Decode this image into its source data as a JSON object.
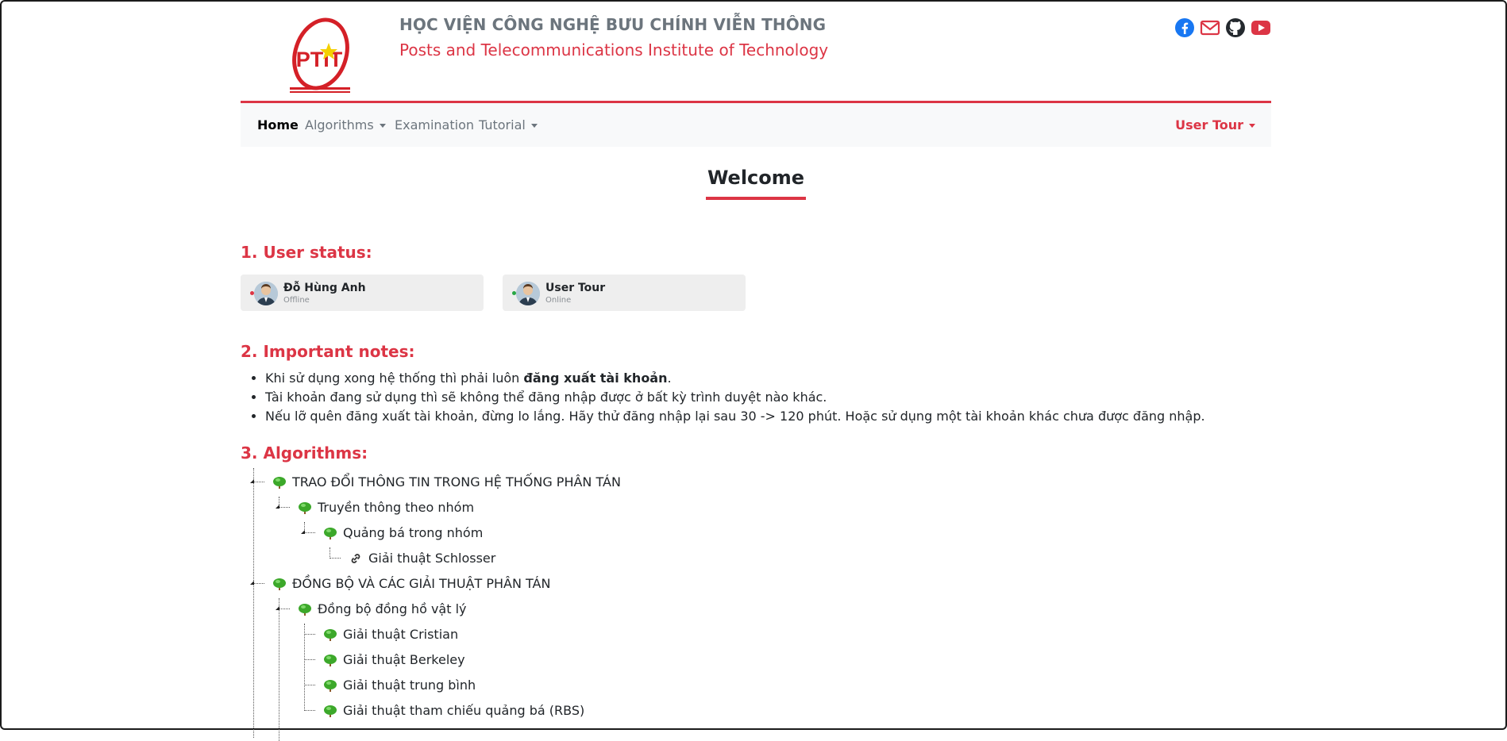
{
  "header": {
    "logo_text": "PTIT",
    "institute_vn": "HỌC VIỆN CÔNG NGHỆ BƯU CHÍNH VIỄN THÔNG",
    "institute_en": "Posts and Telecommunications Institute of Technology",
    "social_icons": [
      "facebook-icon",
      "email-icon",
      "github-icon",
      "youtube-icon"
    ]
  },
  "nav": {
    "home": "Home",
    "algorithms": "Algorithms",
    "examination": "Examination",
    "tutorial": "Tutorial",
    "user": "User Tour"
  },
  "welcome": "Welcome",
  "sections": {
    "user_status": "1. User status:",
    "notes": "2. Important notes:",
    "algorithms": "3. Algorithms:"
  },
  "users": [
    {
      "name": "Đỗ Hùng Anh",
      "status": "Offline",
      "status_color": "#dc3545"
    },
    {
      "name": "User Tour",
      "status": "Online",
      "status_color": "#28a745"
    }
  ],
  "notes": {
    "n1_pre": "Khi sử dụng xong hệ thống thì phải luôn ",
    "n1_bold": "đăng xuất tài khoản",
    "n1_post": ".",
    "n2": "Tài khoản đang sử dụng thì sẽ không thể đăng nhập được ở bất kỳ trình duyệt nào khác.",
    "n3": "Nếu lỡ quên đăng xuất tài khoản, đừng lo lắng. Hãy thử đăng nhập lại sau 30 -> 120 phút. Hoặc sử dụng một tài khoản khác chưa được đăng nhập."
  },
  "tree": [
    {
      "label": "TRAO ĐỔI THÔNG TIN TRONG HỆ THỐNG PHÂN TÁN",
      "icon": "tree-icon"
    },
    {
      "label": "Truyền thông theo nhóm",
      "icon": "tree-icon"
    },
    {
      "label": "Quảng bá trong nhóm",
      "icon": "tree-icon"
    },
    {
      "label": "Giải thuật Schlosser",
      "icon": "link-icon"
    },
    {
      "label": "ĐỒNG BỘ VÀ CÁC GIẢI THUẬT PHÂN TÁN",
      "icon": "tree-icon"
    },
    {
      "label": "Đồng bộ đồng hồ vật lý",
      "icon": "tree-icon"
    },
    {
      "label": "Giải thuật Cristian",
      "icon": "tree-icon"
    },
    {
      "label": "Giải thuật Berkeley",
      "icon": "tree-icon"
    },
    {
      "label": "Giải thuật trung bình",
      "icon": "tree-icon"
    },
    {
      "label": "Giải thuật tham chiếu quảng bá (RBS)",
      "icon": "tree-icon"
    }
  ],
  "colors": {
    "accent": "#dc3545",
    "muted": "#6c757d",
    "navbar_bg": "#f8f9fa",
    "card_bg": "#eeeeee"
  }
}
